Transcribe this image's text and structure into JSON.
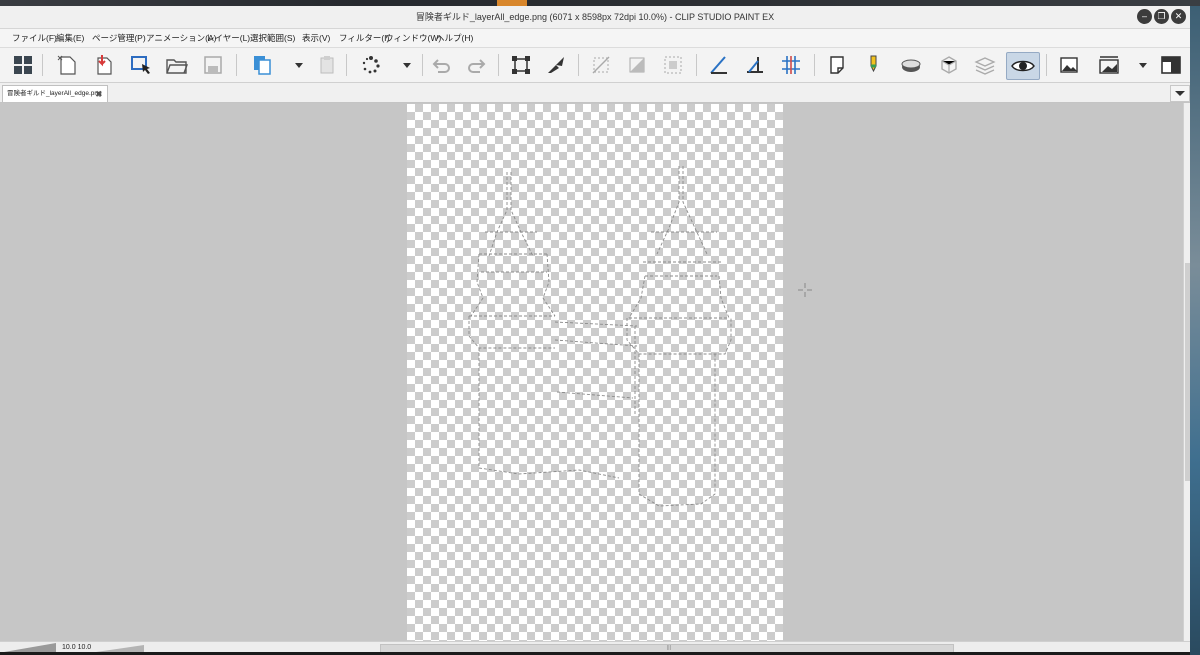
{
  "window": {
    "title": "冒険者ギルド_layerAll_edge.png (6071 x 8598px 72dpi 10.0%) - CLIP STUDIO PAINT EX",
    "controls": [
      "minimize",
      "restore",
      "close"
    ]
  },
  "menu": [
    "ファイル(F)",
    "編集(E)",
    "ページ管理(P)",
    "アニメーション(A)",
    "レイヤー(L)",
    "選択範囲(S)",
    "表示(V)",
    "フィルター(I)",
    "ウィンドウ(W)",
    "ヘルプ(H)"
  ],
  "toolbar": {
    "icons": [
      "grid-icon",
      "new-file-icon",
      "import-icon",
      "select-tool-icon",
      "open-folder-icon",
      "save-icon",
      "copy-pages-icon",
      "dropdown-arrow-icon",
      "paste-icon",
      "dots-spinner-icon",
      "dropdown-arrow-icon",
      "undo-icon",
      "redo-icon",
      "transform-icon",
      "sharpen-icon",
      "deselect-icon",
      "invert-selection-icon",
      "select-all-icon",
      "ruler-snap-icon",
      "special-ruler-icon",
      "grid-snap-icon",
      "draft-layer-icon",
      "pen-color-icon",
      "reference-layer-icon",
      "3d-object-icon",
      "layer-stack-icon",
      "preview-eye-icon",
      "canvas-picture-icon",
      "fit-canvas-icon",
      "dropdown-arrow-icon",
      "window-layout-icon"
    ],
    "active": "preview-eye-icon"
  },
  "document_tab": {
    "label": "冒険者ギルド_layerAll_edge.png",
    "close_symbol": "✖"
  },
  "status": {
    "zoom": "10.0  10.0"
  },
  "colors": {
    "canvas_bg": "#c6c6c6",
    "checker_dark": "#cccccc",
    "checker_light": "#ffffff",
    "line_art": "#8a8a8a"
  }
}
